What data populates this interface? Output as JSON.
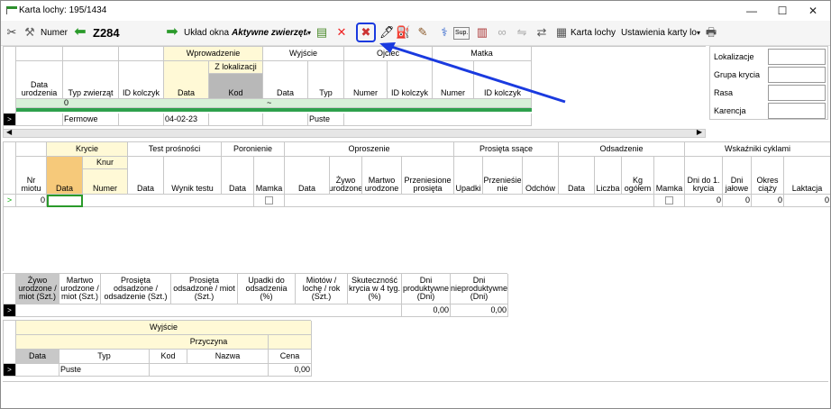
{
  "window": {
    "title": "Karta lochy: 195/1434",
    "min": "—",
    "max": "☐",
    "close": "✕"
  },
  "toolbar": {
    "numer_label": "Numer",
    "numer_value": "Z284",
    "uklad_label": "Układ okna",
    "aktywne_label": "Aktywne zwierzęta",
    "sup": "Sup.",
    "karta_label": "Karta lochy",
    "ustawienia_label": "Ustawienia karty loc"
  },
  "top": {
    "groups": {
      "wprowadzenie": "Wprowadzenie",
      "z_lokalizacji": "Z lokalizacji",
      "wyjscie": "Wyjście",
      "ojciec": "Ojciec",
      "matka": "Matka"
    },
    "cols": {
      "data_urodzenia": "Data urodzenia",
      "typ": "Typ zwierząt",
      "id": "ID kolczyk",
      "data": "Data",
      "kod": "Kod",
      "wdata": "Data",
      "wtyp": "Typ",
      "onum": "Numer",
      "oid": "ID kolczyk",
      "mnum": "Numer",
      "mid": "ID kolczyk"
    },
    "filter": {
      "zero": "0",
      "tilde": "~"
    },
    "row": {
      "typ": "Fermowe",
      "data": "04-02-23",
      "wtyp": "Puste"
    }
  },
  "side": {
    "lokalizacje": "Lokalizacje",
    "grupa": "Grupa krycia",
    "rasa": "Rasa",
    "karencja": "Karencja"
  },
  "mid": {
    "groups": {
      "krycie": "Krycie",
      "knur": "Knur",
      "test": "Test prośności",
      "poronienie": "Poronienie",
      "oproszenie": "Oproszenie",
      "prosieta": "Prosięta ssące",
      "odsadzenie": "Odsadzenie",
      "wskazniki": "Wskaźniki cyklami"
    },
    "cols": [
      "Nr miotu",
      "Data",
      "Numer",
      "Data",
      "Wynik testu",
      "Data",
      "Mamka",
      "Data",
      "Żywo urodzone",
      "Martwo urodzone",
      "Przeniesione prosięta",
      "Upadki",
      "Przenieśie nie",
      "Odchów",
      "Data",
      "Liczba",
      "Kg ogółem",
      "Mamka",
      "Dni do 1. krycia",
      "Dni jałowe",
      "Okres ciąży",
      "Laktacja"
    ],
    "row": {
      "nr": "0",
      "dni1": "0",
      "jalowe": "0",
      "ciazy": "0",
      "laktacja": "0"
    }
  },
  "stats": {
    "cols": [
      "Żywo urodzone / miot (Szt.)",
      "Martwo urodzone / miot (Szt.)",
      "Prosięta odsadzone / odsadzenie (Szt.)",
      "Prosięta odsadzone / miot (Szt.)",
      "Upadki do odsadzenia (%)",
      "Miotów / lochę / rok (Szt.)",
      "Skuteczność krycia w 4 tyg. (%)",
      "Dni produktywne (Dni)",
      "Dni nieproduktywne (Dni)"
    ],
    "v1": "0,00",
    "v2": "0,00"
  },
  "bottom": {
    "wyjscie": "Wyjście",
    "przyczyna": "Przyczyna",
    "cols": {
      "data": "Data",
      "typ": "Typ",
      "kod": "Kod",
      "nazwa": "Nazwa",
      "cena": "Cena"
    },
    "row": {
      "typ": "Puste",
      "cena": "0,00"
    }
  }
}
